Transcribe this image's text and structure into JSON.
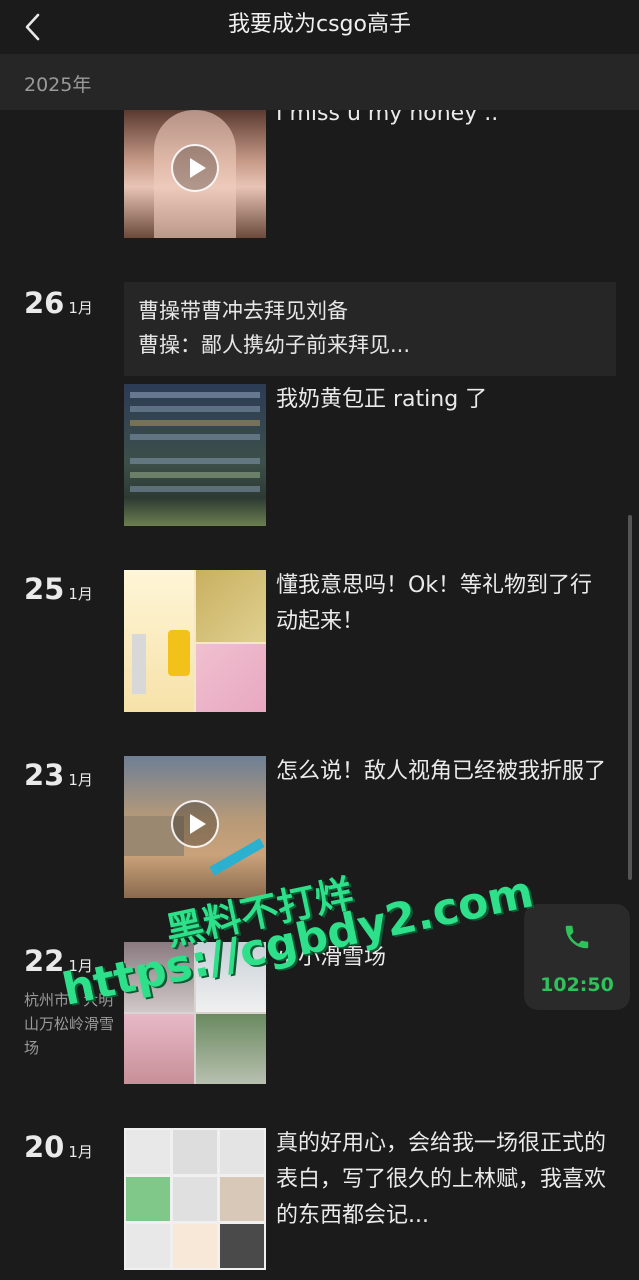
{
  "header": {
    "title": "我要成为csgo高手"
  },
  "year_label": "2025年",
  "top_partial_post": {
    "text": "I miss u my honey ..",
    "has_video": true
  },
  "posts": [
    {
      "day": "26",
      "month": "1月",
      "share": {
        "line1": "曹操带曹冲去拜见刘备",
        "line2": "曹操：鄙人携幼子前来拜见..."
      },
      "text": "我奶黄包正 rating 了"
    },
    {
      "day": "25",
      "month": "1月",
      "text": "懂我意思吗！Ok！等礼物到了行动起来！"
    },
    {
      "day": "23",
      "month": "1月",
      "text": "怎么说！敌人视角已经被我折服了",
      "has_video": true
    },
    {
      "day": "22",
      "month": "1月",
      "location": "杭州市 · 大明山万松岭滑雪场",
      "text": "小小滑雪场"
    },
    {
      "day": "20",
      "month": "1月",
      "text": "真的好用心，会给我一场很正式的表白，写了很久的上林赋，我喜欢的东西都会记..."
    }
  ],
  "call_widget": {
    "duration": "102:50",
    "icon": "phone-icon",
    "color": "#2fc25b"
  },
  "watermark": {
    "line1": "黑料不打烊",
    "line2": "https://cgbdy2.com"
  }
}
